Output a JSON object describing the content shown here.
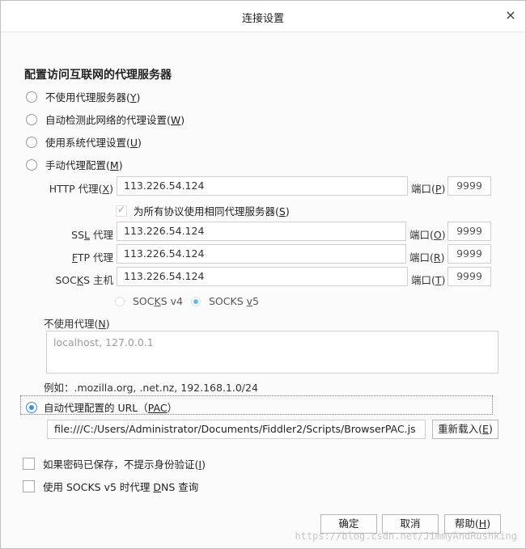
{
  "window": {
    "title": "连接设置",
    "close_glyph": "×"
  },
  "section_title": "配置访问互联网的代理服务器",
  "proxy_options": {
    "no_proxy": {
      "text": "不使用代理服务器(",
      "key": "Y",
      "end": ")"
    },
    "auto_detect": {
      "text": "自动检测此网络的代理设置(",
      "key": "W",
      "end": ")"
    },
    "system": {
      "text": "使用系统代理设置(",
      "key": "U",
      "end": ")"
    },
    "manual": {
      "text": "手动代理配置(",
      "key": "M",
      "end": ")"
    },
    "pac": {
      "text": "自动代理配置的 URL（",
      "key": "PAC",
      "end": "）"
    },
    "selected": "pac"
  },
  "manual": {
    "http": {
      "label_pre": "HTTP 代理(",
      "key": "X",
      "label_post": ")",
      "value": "113.226.54.124",
      "port_pre": "端口(",
      "port_key": "P",
      "port_post": ")",
      "port": "9999"
    },
    "same_for_all": {
      "text": "为所有协议使用相同代理服务器(",
      "key": "S",
      "end": ")",
      "checked": true
    },
    "ssl": {
      "label_pre": "SS",
      "key": "L",
      "label_post": " 代理",
      "value": "113.226.54.124",
      "port_pre": "端口(",
      "port_key": "O",
      "port_post": ")",
      "port": "9999"
    },
    "ftp": {
      "label_pre": "",
      "key": "F",
      "label_post": "TP 代理",
      "value": "113.226.54.124",
      "port_pre": "端口(",
      "port_key": "R",
      "port_post": ")",
      "port": "9999"
    },
    "socks": {
      "label_pre": "SOC",
      "key": "K",
      "label_post": "S 主机",
      "value": "113.226.54.124",
      "port_pre": "端口(",
      "port_key": "T",
      "port_post": ")",
      "port": "9999"
    },
    "socks_v4": {
      "pre": "SOC",
      "key": "K",
      "post": "S v4"
    },
    "socks_v5": {
      "pre": "SOCKS ",
      "key": "v",
      "post": "5",
      "selected": true
    }
  },
  "no_proxy_for": {
    "label_pre": "不使用代理(",
    "key": "N",
    "label_post": ")",
    "value": "localhost, 127.0.0.1",
    "example": "例如：.mozilla.org, .net.nz, 192.168.1.0/24"
  },
  "pac_url": {
    "value": "file:///C:/Users/Administrator/Documents/Fiddler2/Scripts/BrowserPAC.js",
    "reload_pre": "重新载入(",
    "reload_key": "E",
    "reload_post": ")"
  },
  "options": {
    "no_auth_prompt": {
      "text": "如果密码已保存，不提示身份验证(",
      "key": "I",
      "end": ")",
      "checked": false
    },
    "socks_dns": {
      "pre": "使用 SOCKS v5 时代理 ",
      "key": "D",
      "post": "NS 查询",
      "checked": false
    }
  },
  "buttons": {
    "ok": "确定",
    "cancel": "取消",
    "help_pre": "帮助(",
    "help_key": "H",
    "help_post": ")"
  },
  "watermark": "https://blog.csdn.net/JimmyAndRushking"
}
